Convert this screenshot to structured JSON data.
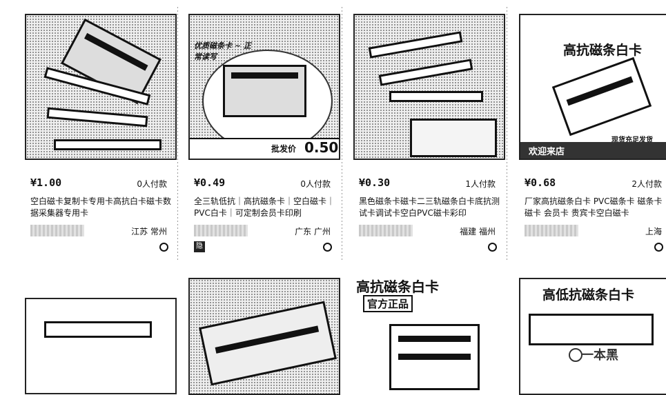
{
  "products": [
    {
      "price": "¥1.00",
      "paid": "0人付款",
      "title": "空白磁卡复制卡专用卡高抗白卡磁卡数据采集器专用卡",
      "location": "江苏 常州"
    },
    {
      "price": "¥0.49",
      "paid": "0人付款",
      "title": "全三轨低抗｜高抗磁条卡｜空白磁卡｜PVC白卡｜可定制会员卡印刷",
      "location": "广东 广州",
      "badge": "隐",
      "image_banner": "批发价",
      "image_price": "0.50",
      "image_caption": "优质磁条卡 ~ 正常读写"
    },
    {
      "price": "¥0.30",
      "paid": "1人付款",
      "title": "黑色磁条卡磁卡二三轨磁条白卡底抗测试卡调试卡空白PVC磁卡彩印",
      "location": "福建 福州"
    },
    {
      "price": "¥0.68",
      "paid": "2人付款",
      "title": "厂家高抗磁条白卡 PVC磁条卡 磁条卡磁卡 会员卡 贵宾卡空白磁卡",
      "location": "上海",
      "image_title": "高抗磁条白卡",
      "image_note": "现货充足发货",
      "image_footer": "欢迎来店"
    }
  ],
  "row2": {
    "card3_title": "高抗磁条白卡",
    "card3_badge": "官方正品",
    "card4_title": "高低抗磁条白卡",
    "watermark": "一本黑"
  }
}
